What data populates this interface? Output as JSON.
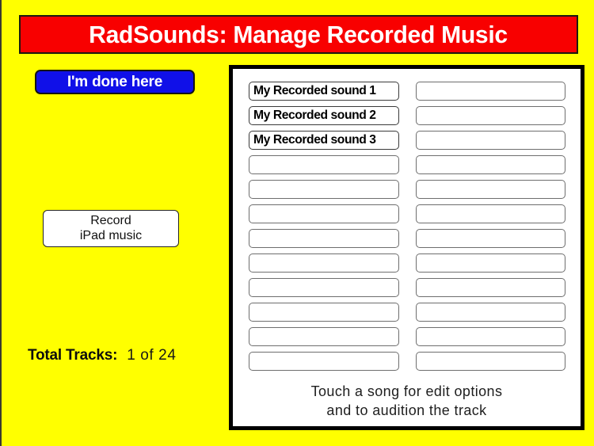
{
  "app": {
    "title": "RadSounds: Manage Recorded Music",
    "background_color": "#FFFF00"
  },
  "header": {
    "title": "RadSounds: Manage Recorded Music",
    "background_color": "#F80000",
    "text_color": "#FFFFFF"
  },
  "sidebar": {
    "done_button": {
      "label": "I'm done here",
      "background_color": "#1010E8",
      "text_color": "#FFFFFF"
    },
    "record_button": {
      "line1": "Record",
      "line2": "iPad music",
      "background_color": "#FFFFFF",
      "text_color": "#111111"
    },
    "totals": {
      "label": "Total Tracks:",
      "value": "1  of  24",
      "count": 1,
      "capacity": 24
    }
  },
  "track_panel": {
    "hint_line1": "Touch a song for edit options",
    "hint_line2": "and to audition the track",
    "border_color": "#000000",
    "background_color": "#FFFFFF",
    "rows_per_column": 12,
    "left_column": [
      {
        "label": "My Recorded sound 1",
        "filled": true
      },
      {
        "label": "My Recorded sound 2",
        "filled": true
      },
      {
        "label": "My Recorded sound 3",
        "filled": true
      },
      {
        "label": "",
        "filled": false
      },
      {
        "label": "",
        "filled": false
      },
      {
        "label": "",
        "filled": false
      },
      {
        "label": "",
        "filled": false
      },
      {
        "label": "",
        "filled": false
      },
      {
        "label": "",
        "filled": false
      },
      {
        "label": "",
        "filled": false
      },
      {
        "label": "",
        "filled": false
      },
      {
        "label": "",
        "filled": false
      }
    ],
    "right_column": [
      {
        "label": "",
        "filled": false
      },
      {
        "label": "",
        "filled": false
      },
      {
        "label": "",
        "filled": false
      },
      {
        "label": "",
        "filled": false
      },
      {
        "label": "",
        "filled": false
      },
      {
        "label": "",
        "filled": false
      },
      {
        "label": "",
        "filled": false
      },
      {
        "label": "",
        "filled": false
      },
      {
        "label": "",
        "filled": false
      },
      {
        "label": "",
        "filled": false
      },
      {
        "label": "",
        "filled": false
      },
      {
        "label": "",
        "filled": false
      }
    ]
  }
}
